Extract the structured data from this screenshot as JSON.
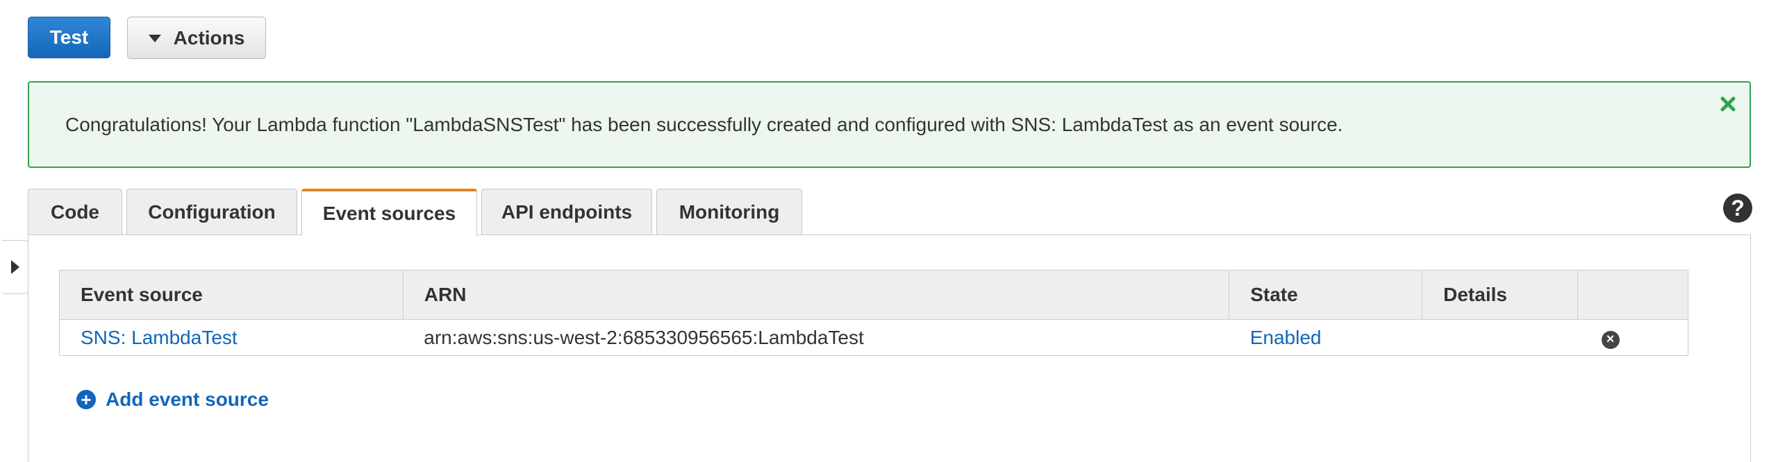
{
  "toolbar": {
    "test_label": "Test",
    "actions_label": "Actions"
  },
  "banner": {
    "message": "Congratulations! Your Lambda function \"LambdaSNSTest\" has been successfully created and configured with SNS: LambdaTest as an event source.",
    "close_icon": "close-x-icon"
  },
  "tabs": [
    {
      "label": "Code"
    },
    {
      "label": "Configuration"
    },
    {
      "label": "Event sources",
      "active": true
    },
    {
      "label": "API endpoints"
    },
    {
      "label": "Monitoring"
    }
  ],
  "help": {
    "icon": "question-circle-icon",
    "glyph": "?"
  },
  "event_table": {
    "columns": [
      "Event source",
      "ARN",
      "State",
      "Details",
      ""
    ],
    "rows": [
      {
        "event_source": "SNS: LambdaTest",
        "arn": "arn:aws:sns:us-west-2:685330956565:LambdaTest",
        "state": "Enabled",
        "details": ""
      }
    ]
  },
  "add_event_source_label": "Add event source",
  "colors": {
    "primary_button": "#1566b8",
    "success_border": "#2ea44f",
    "success_bg": "#eef7ef",
    "active_tab_accent": "#e8821e",
    "link": "#1166bb"
  }
}
